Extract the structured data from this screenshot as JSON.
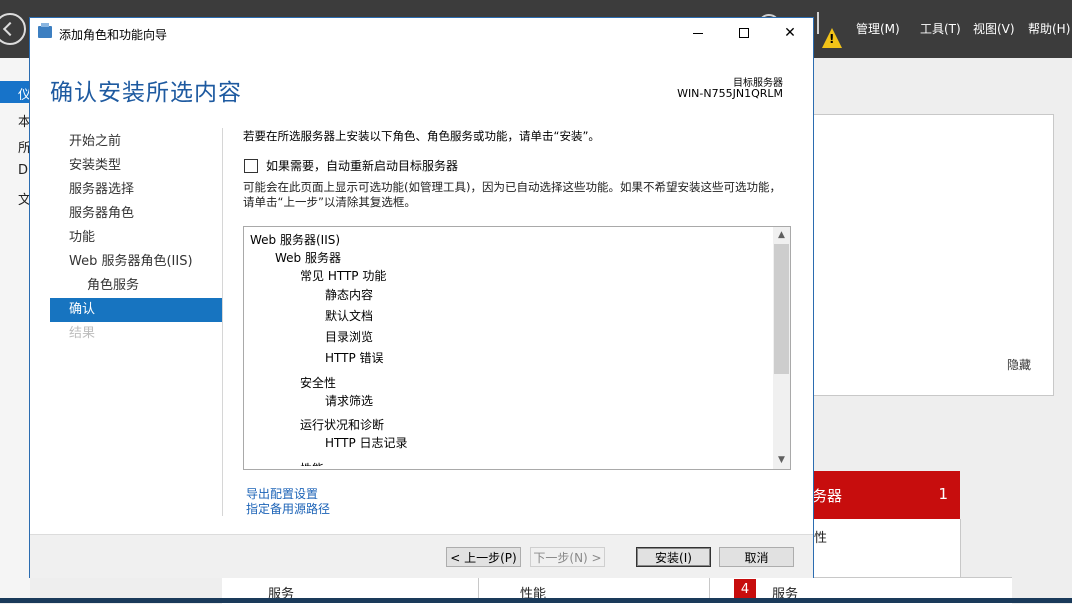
{
  "background": {
    "menu": [
      "管理(M)",
      "工具(T)",
      "视图(V)",
      "帮助(H)"
    ],
    "warning_glyph": "!",
    "nav": [
      "仪",
      "本",
      "所",
      "D",
      "文"
    ],
    "panel_hide": "隐藏",
    "red_card": {
      "title": "务器",
      "count": "1",
      "line": "性"
    },
    "bottom": {
      "c1": "服务",
      "c2": "性能",
      "badge": "4",
      "c3": "服务"
    }
  },
  "dialog": {
    "title": "添加角色和功能向导",
    "buttons": {
      "close_glyph": "✕"
    },
    "heading": "确认安装所选内容",
    "target_label": "目标服务器",
    "target_name": "WIN-N755JN1QRLM",
    "nav": [
      {
        "label": "开始之前",
        "state": "normal"
      },
      {
        "label": "安装类型",
        "state": "normal"
      },
      {
        "label": "服务器选择",
        "state": "normal"
      },
      {
        "label": "服务器角色",
        "state": "normal"
      },
      {
        "label": "功能",
        "state": "normal"
      },
      {
        "label": "Web 服务器角色(IIS)",
        "state": "normal"
      },
      {
        "label": "角色服务",
        "state": "sub"
      },
      {
        "label": "确认",
        "state": "active"
      },
      {
        "label": "结果",
        "state": "disabled"
      }
    ],
    "intro": "若要在所选服务器上安装以下角色、角色服务或功能，请单击“安装”。",
    "restart_checkbox": {
      "label": "如果需要，自动重新启动目标服务器",
      "checked": false
    },
    "note": "可能会在此页面上显示可选功能(如管理工具)，因为已自动选择这些功能。如果不希望安装这些可选功能，请单击“上一步”以清除其复选框。",
    "list": [
      {
        "text": "Web 服务器(IIS)",
        "level": 0
      },
      {
        "text": "Web 服务器",
        "level": 1
      },
      {
        "text": "常见 HTTP 功能",
        "level": 2
      },
      {
        "text": "静态内容",
        "level": 3
      },
      {
        "text": "默认文档",
        "level": 3
      },
      {
        "text": "目录浏览",
        "level": 3
      },
      {
        "text": "HTTP 错误",
        "level": 3
      },
      {
        "text": "安全性",
        "level": 2
      },
      {
        "text": "请求筛选",
        "level": 3
      },
      {
        "text": "运行状况和诊断",
        "level": 2
      },
      {
        "text": "HTTP 日志记录",
        "level": 3
      },
      {
        "text": "性能",
        "level": 2
      }
    ],
    "scroll": {
      "up": "▲",
      "down": "▼"
    },
    "links": {
      "export": "导出配置设置",
      "alt_source": "指定备用源路径"
    },
    "footer": {
      "back": "< 上一步(P)",
      "next": "下一步(N) >",
      "install": "安装(I)",
      "cancel": "取消"
    }
  }
}
